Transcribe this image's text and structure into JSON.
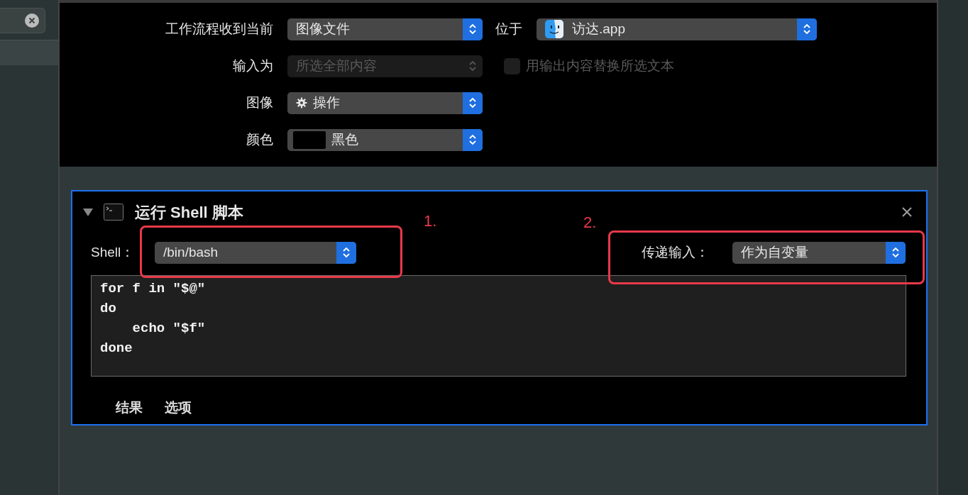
{
  "workflow_settings": {
    "rows": [
      {
        "kind": "popup",
        "label": "工作流程收到当前",
        "value": "图像文件",
        "disabled": false,
        "extra": {
          "label": "位于",
          "value": "访达.app"
        }
      },
      {
        "kind": "popup",
        "label": "输入为",
        "value": "所选全部内容",
        "disabled": true,
        "checkbox": {
          "label": "用输出内容替换所选文本",
          "checked": false,
          "disabled": true
        }
      },
      {
        "kind": "action",
        "label": "图像",
        "value": "操作",
        "disabled": false
      },
      {
        "kind": "color",
        "label": "颜色",
        "value": "黑色",
        "color": "#000000",
        "disabled": false
      }
    ]
  },
  "action": {
    "title": "运行 Shell 脚本",
    "expanded": true,
    "selected": true,
    "shell": {
      "label": "Shell：",
      "value": "/bin/bash"
    },
    "pass_input": {
      "label": "传递输入：",
      "value": "作为自变量"
    },
    "script": "for f in \"$@\"\ndo\n    echo \"$f\"\ndone",
    "tabs": [
      {
        "label": "结果"
      },
      {
        "label": "选项"
      }
    ]
  },
  "annotations": [
    {
      "label": "1."
    },
    {
      "label": "2."
    }
  ]
}
